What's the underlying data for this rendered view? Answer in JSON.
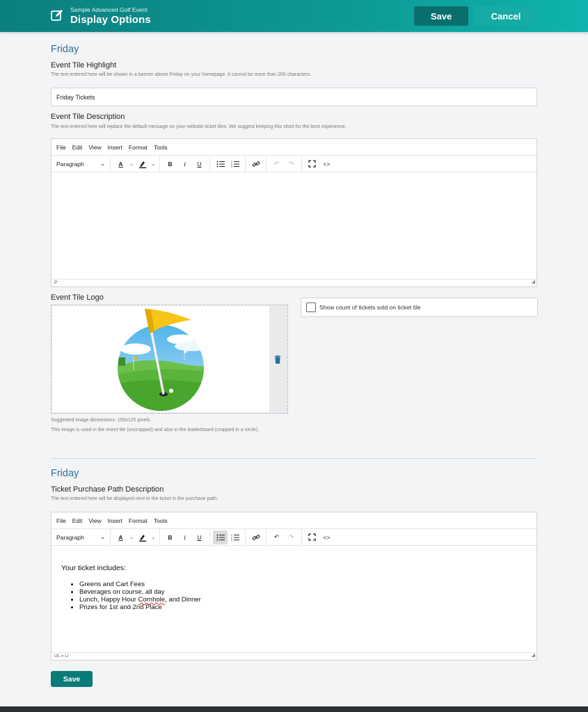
{
  "header": {
    "event_name": "Sample Advanced Golf Event",
    "page_title": "Display Options",
    "save_label": "Save",
    "cancel_label": "Cancel"
  },
  "section1": {
    "title": "Friday",
    "highlight_label": "Event Tile Highlight",
    "highlight_help": "The text entered here will be shown in a banner above Friday on your homepage. It cannot be more than 200 characters.",
    "highlight_value": "Friday Tickets",
    "description_label": "Event Tile Description",
    "description_help": "The text entered here will replace the default message on your website ticket tiles. We suggest keeping this short for the best experience.",
    "description_status": "P",
    "logo_label": "Event Tile Logo",
    "logo_hint1": "Suggested image dimensions: 150x125 pixels.",
    "logo_hint2": "This image is used in the event tile (uncropped) and also in the leaderboard (cropped in a circle).",
    "show_count_label": "Show count of tickets sold on ticket tile",
    "show_count_checked": false
  },
  "editor_menu": [
    "File",
    "Edit",
    "View",
    "Insert",
    "Format",
    "Tools"
  ],
  "block_format": "Paragraph",
  "section2": {
    "title": "Friday",
    "path_label": "Ticket Purchase Path Description",
    "path_help": "The text entered here will be displayed next to the ticket in the purchase path.",
    "content_intro": "Your ticket includes:",
    "content_items": [
      "Greens and Cart Fees",
      "Beverages on course, all day",
      "Lunch, Happy Hour Cornhole, and Dinner",
      "Prizes for 1st and 2nd Place"
    ],
    "item3_before": "Lunch, Happy Hour ",
    "item3_misspelled": "Cornhole",
    "item3_after": ", and Dinner",
    "status_path": "UL » LI"
  },
  "save_bottom_label": "Save",
  "colors": {
    "header_start": "#0b7f7f",
    "header_end": "#0fb3ad",
    "section_title": "#2a6f97",
    "primary_button": "#0a7c78"
  }
}
